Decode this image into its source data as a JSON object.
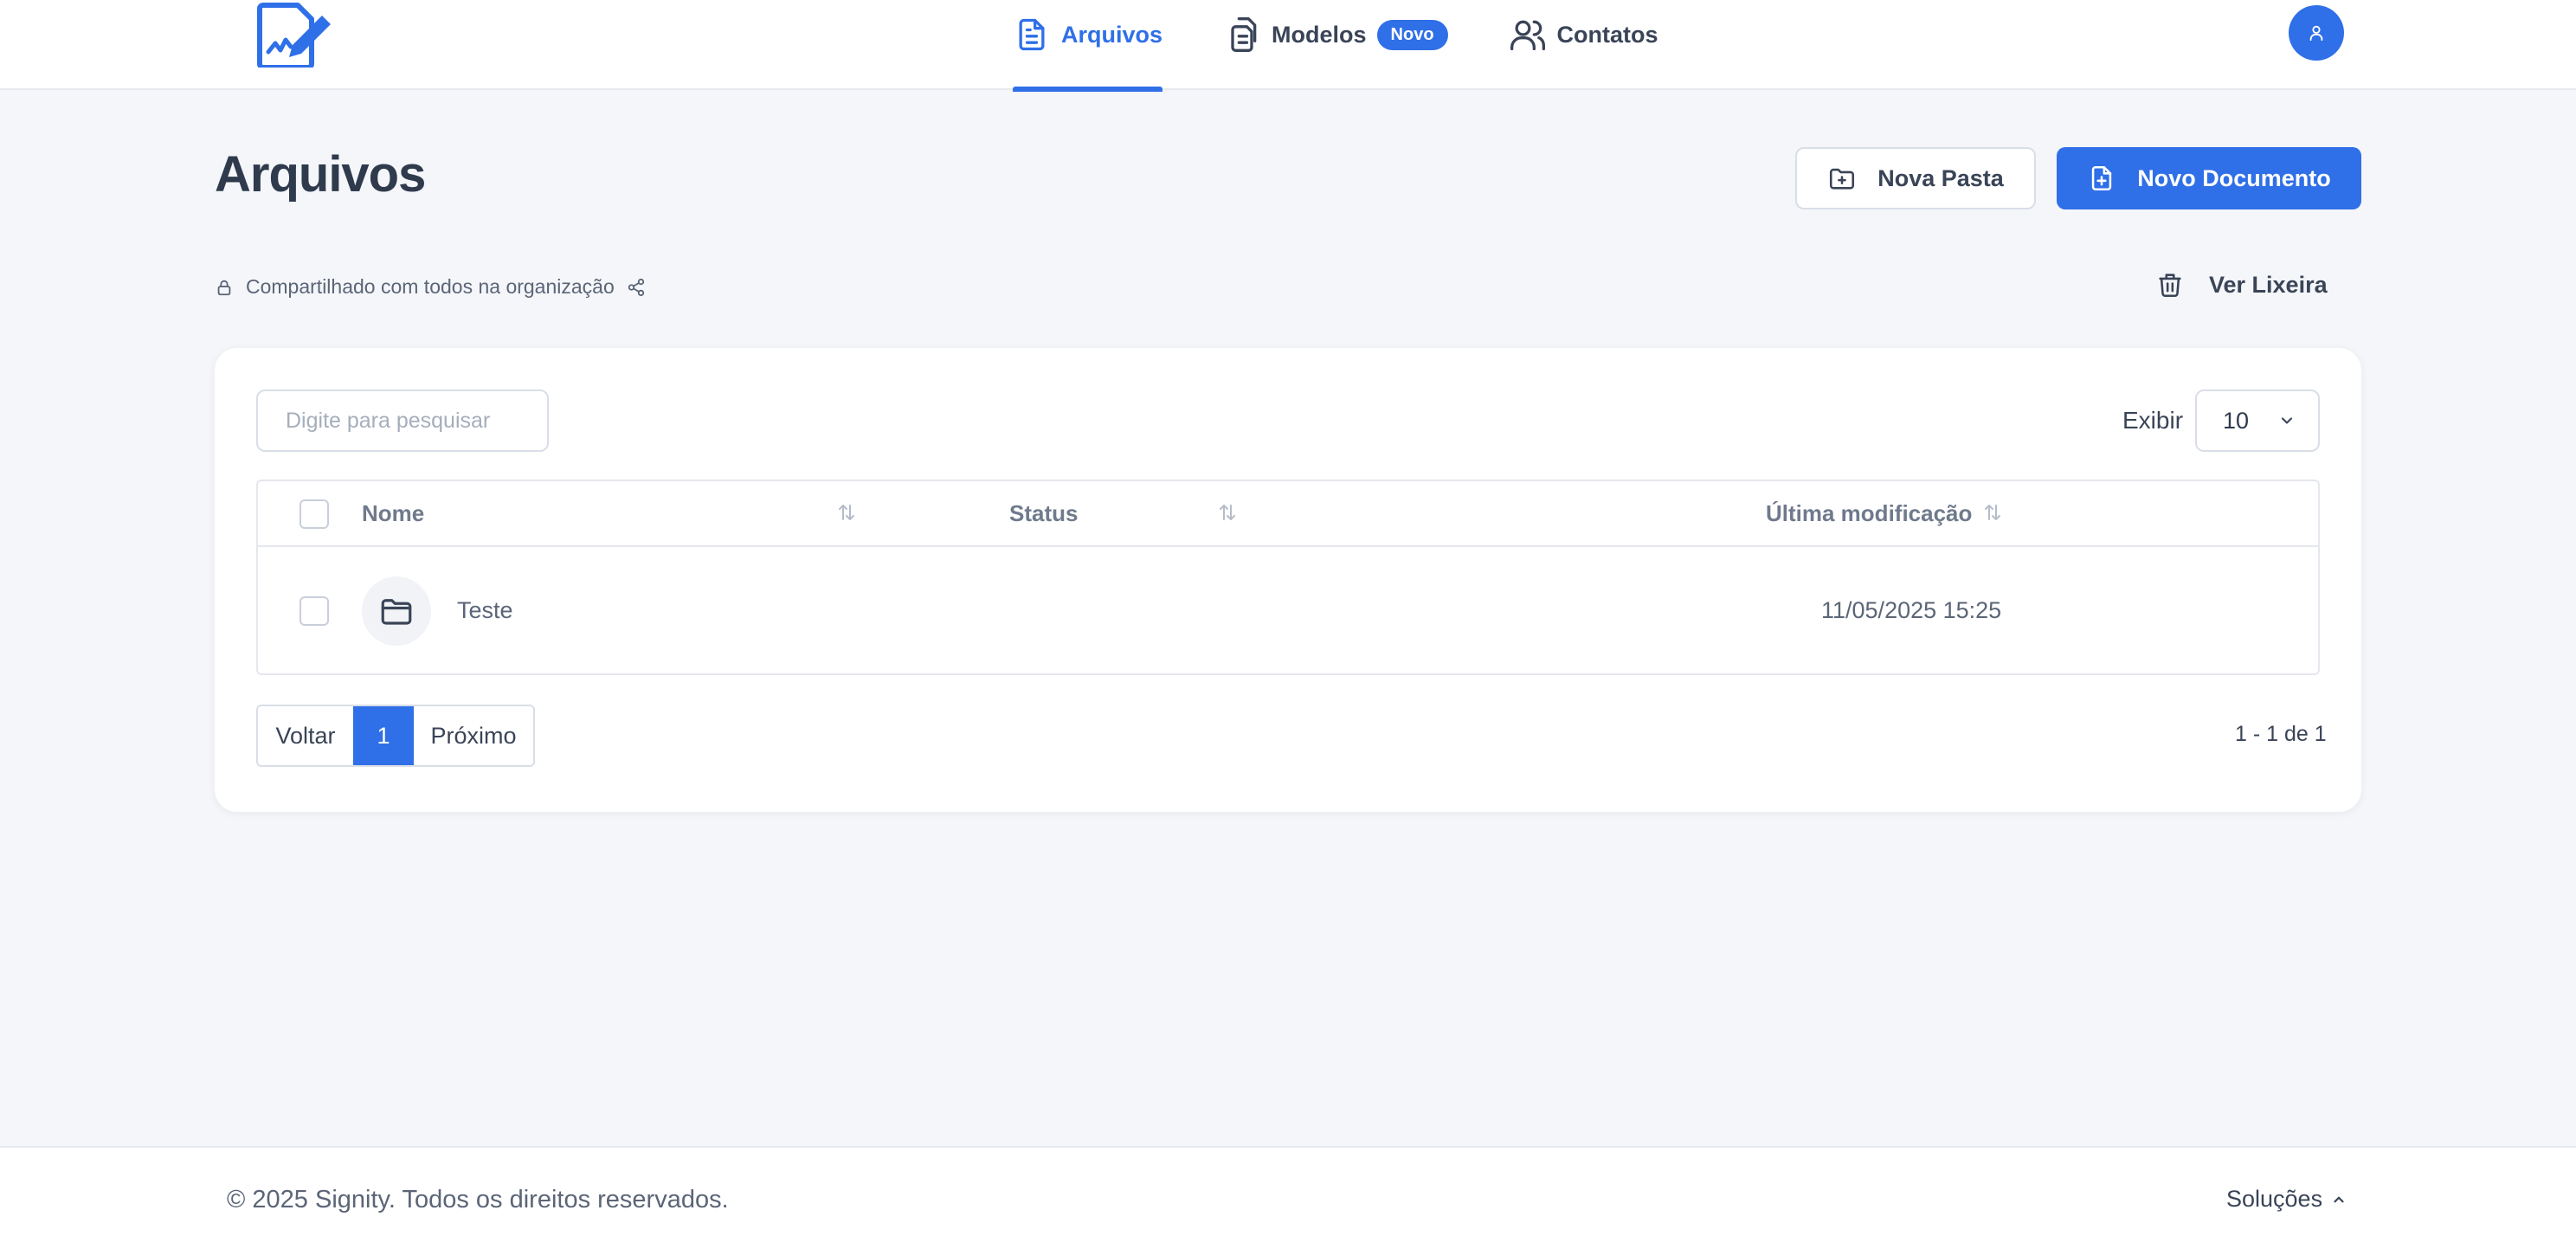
{
  "header": {
    "nav": [
      {
        "label": "Arquivos",
        "icon": "document-icon",
        "active": true
      },
      {
        "label": "Modelos",
        "icon": "copy-document-icon",
        "badge": "Novo"
      },
      {
        "label": "Contatos",
        "icon": "users-icon"
      }
    ],
    "accent_color": "#2f6fe8"
  },
  "page": {
    "title": "Arquivos",
    "new_folder_label": "Nova Pasta",
    "new_document_label": "Novo Documento",
    "shared_text": "Compartilhado com todos na organização",
    "trash_label": "Ver Lixeira"
  },
  "table": {
    "search_placeholder": "Digite para pesquisar",
    "show_label": "Exibir",
    "page_size": "10",
    "columns": [
      "Nome",
      "Status",
      "Última modificação"
    ],
    "rows": [
      {
        "name": "Teste",
        "status": "",
        "modified": "11/05/2025 15:25",
        "type": "folder"
      }
    ]
  },
  "pagination": {
    "prev_label": "Voltar",
    "current_page": "1",
    "next_label": "Próximo",
    "range_text": "1 - 1 de 1"
  },
  "footer": {
    "copyright": "© 2025 Signity. Todos os direitos reservados.",
    "solutions_label": "Soluções"
  }
}
